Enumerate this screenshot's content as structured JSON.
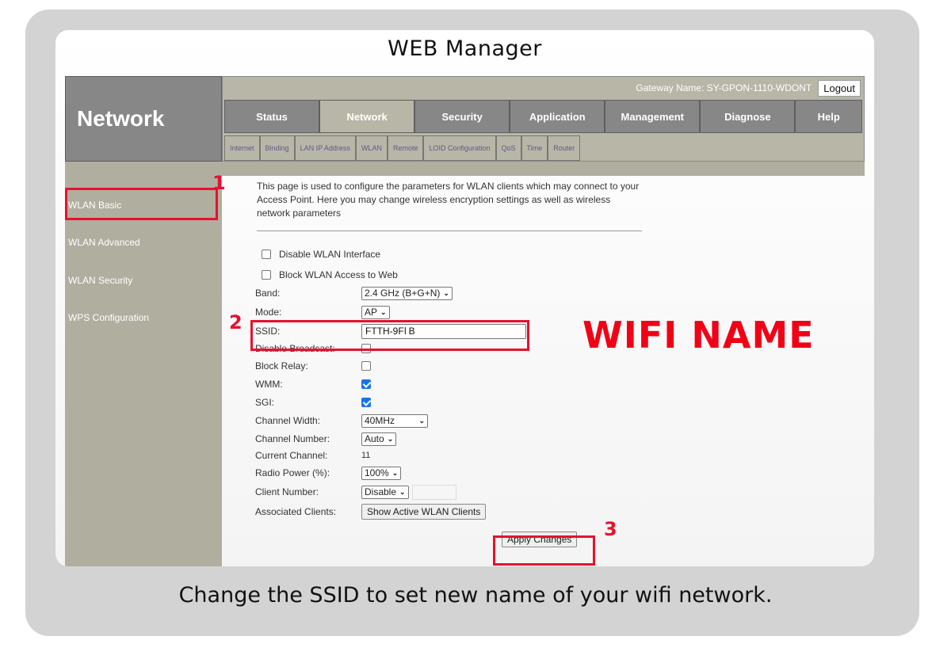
{
  "app_title": "WEB Manager",
  "brand": "Network",
  "gateway": {
    "label": "Gateway Name: SY-GPON-1110-WDONT",
    "logout_label": "Logout"
  },
  "main_tabs": [
    {
      "label": "Status",
      "active": false
    },
    {
      "label": "Network",
      "active": true
    },
    {
      "label": "Security",
      "active": false
    },
    {
      "label": "Application",
      "active": false
    },
    {
      "label": "Management",
      "active": false
    },
    {
      "label": "Diagnose",
      "active": false
    },
    {
      "label": "Help",
      "active": false
    }
  ],
  "sub_tabs": [
    "Internet",
    "Binding",
    "LAN IP Address",
    "WLAN",
    "Remote",
    "LOID Configuration",
    "QoS",
    "Time",
    "Router"
  ],
  "sidebar": {
    "items": [
      {
        "label": "WLAN Basic",
        "active": true
      },
      {
        "label": "WLAN Advanced",
        "active": false
      },
      {
        "label": "WLAN Security",
        "active": false
      },
      {
        "label": "WPS Configuration",
        "active": false
      }
    ]
  },
  "content": {
    "description": "This page is used to configure the parameters for WLAN clients which may connect to your Access Point. Here you may change wireless encryption settings as well as wireless network parameters",
    "disable_wlan_label": "Disable WLAN Interface",
    "disable_wlan_checked": false,
    "block_wlan_label": "Block WLAN Access to Web",
    "block_wlan_checked": false,
    "fields": {
      "band": {
        "label": "Band:",
        "value": "2.4 GHz (B+G+N)"
      },
      "mode": {
        "label": "Mode:",
        "value": "AP"
      },
      "ssid": {
        "label": "SSID:",
        "value": "FTTH-9F",
        "value_suffix": "B"
      },
      "disable_broadcast": {
        "label": "Disable Broadcast:",
        "checked": false
      },
      "block_relay": {
        "label": "Block Relay:",
        "checked": false
      },
      "wmm": {
        "label": "WMM:",
        "checked": true
      },
      "sgi": {
        "label": "SGI:",
        "checked": true
      },
      "channel_width": {
        "label": "Channel Width:",
        "value": "40MHz"
      },
      "channel_number": {
        "label": "Channel Number:",
        "value": "Auto"
      },
      "current_channel": {
        "label": "Current Channel:",
        "value": "11"
      },
      "radio_power": {
        "label": "Radio Power (%):",
        "value": "100%"
      },
      "client_number": {
        "label": "Client Number:",
        "value": "Disable",
        "input_value": ""
      },
      "associated_clients": {
        "label": "Associated Clients:",
        "button_label": "Show Active WLAN Clients"
      }
    },
    "apply_label": "Apply Changes"
  },
  "annotations": {
    "step1": "1",
    "step2": "2",
    "step3": "3",
    "wifi_name_label": "WIFI NAME",
    "accent_color": "#e8112d"
  },
  "caption": "Change the SSID to set new name of your wifi network."
}
